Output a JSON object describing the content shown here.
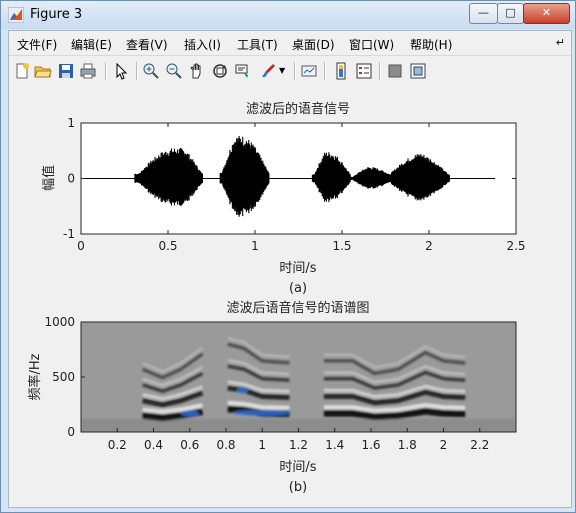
{
  "window": {
    "title": "Figure 3"
  },
  "menu": [
    "文件(F)",
    "编辑(E)",
    "查看(V)",
    "插入(I)",
    "工具(T)",
    "桌面(D)",
    "窗口(W)",
    "帮助(H)"
  ],
  "toolbar_icons": [
    "new-figure-icon",
    "open-file-icon",
    "save-icon",
    "print-icon",
    "pointer-icon",
    "zoom-in-icon",
    "zoom-out-icon",
    "pan-icon",
    "rotate-3d-icon",
    "data-cursor-icon",
    "brush-icon",
    "dropdown-arrow-icon",
    "link-plot-icon",
    "colorbar-icon",
    "legend-icon",
    "hide-plot-tools-icon",
    "show-plot-tools-icon"
  ],
  "chart_data": [
    {
      "type": "line",
      "title": "滤波后的语音信号",
      "xlabel": "时间/s",
      "ylabel": "幅值",
      "caption": "(a)",
      "xlim": [
        0,
        2.5
      ],
      "ylim": [
        -1,
        1
      ],
      "xticks": [
        "0",
        "0.5",
        "1",
        "1.5",
        "2",
        "2.5"
      ],
      "yticks": [
        "-1",
        "0",
        "1"
      ],
      "segments": [
        {
          "start": 0.31,
          "end": 0.7,
          "peak": 0.63,
          "peak_at": 0.6
        },
        {
          "start": 0.8,
          "end": 1.08,
          "peak": 0.85,
          "peak_at": 0.88
        },
        {
          "start": 1.33,
          "end": 1.55,
          "peak": 0.52,
          "peak_at": 1.4
        },
        {
          "start": 1.55,
          "end": 1.8,
          "peak": 0.22,
          "peak_at": 1.65
        },
        {
          "start": 1.75,
          "end": 2.12,
          "peak": 0.47,
          "peak_at": 1.95
        }
      ],
      "line_color": "#000000"
    },
    {
      "type": "heatmap",
      "title": "滤波后语音信号的语谱图",
      "xlabel": "时间/s",
      "ylabel": "频率/Hz",
      "caption": "(b)",
      "xlim": [
        0,
        2.4
      ],
      "ylim": [
        0,
        1000
      ],
      "xticks": [
        "0.2",
        "0.4",
        "0.6",
        "0.8",
        "1",
        "1.2",
        "1.4",
        "1.6",
        "1.8",
        "2",
        "2.2"
      ],
      "yticks": [
        "0",
        "500",
        "1000"
      ],
      "background_color": "#9a9a9a",
      "colors": {
        "dark": "#000000",
        "light": "#ffffff",
        "accent": "#2f6fd6"
      }
    }
  ]
}
